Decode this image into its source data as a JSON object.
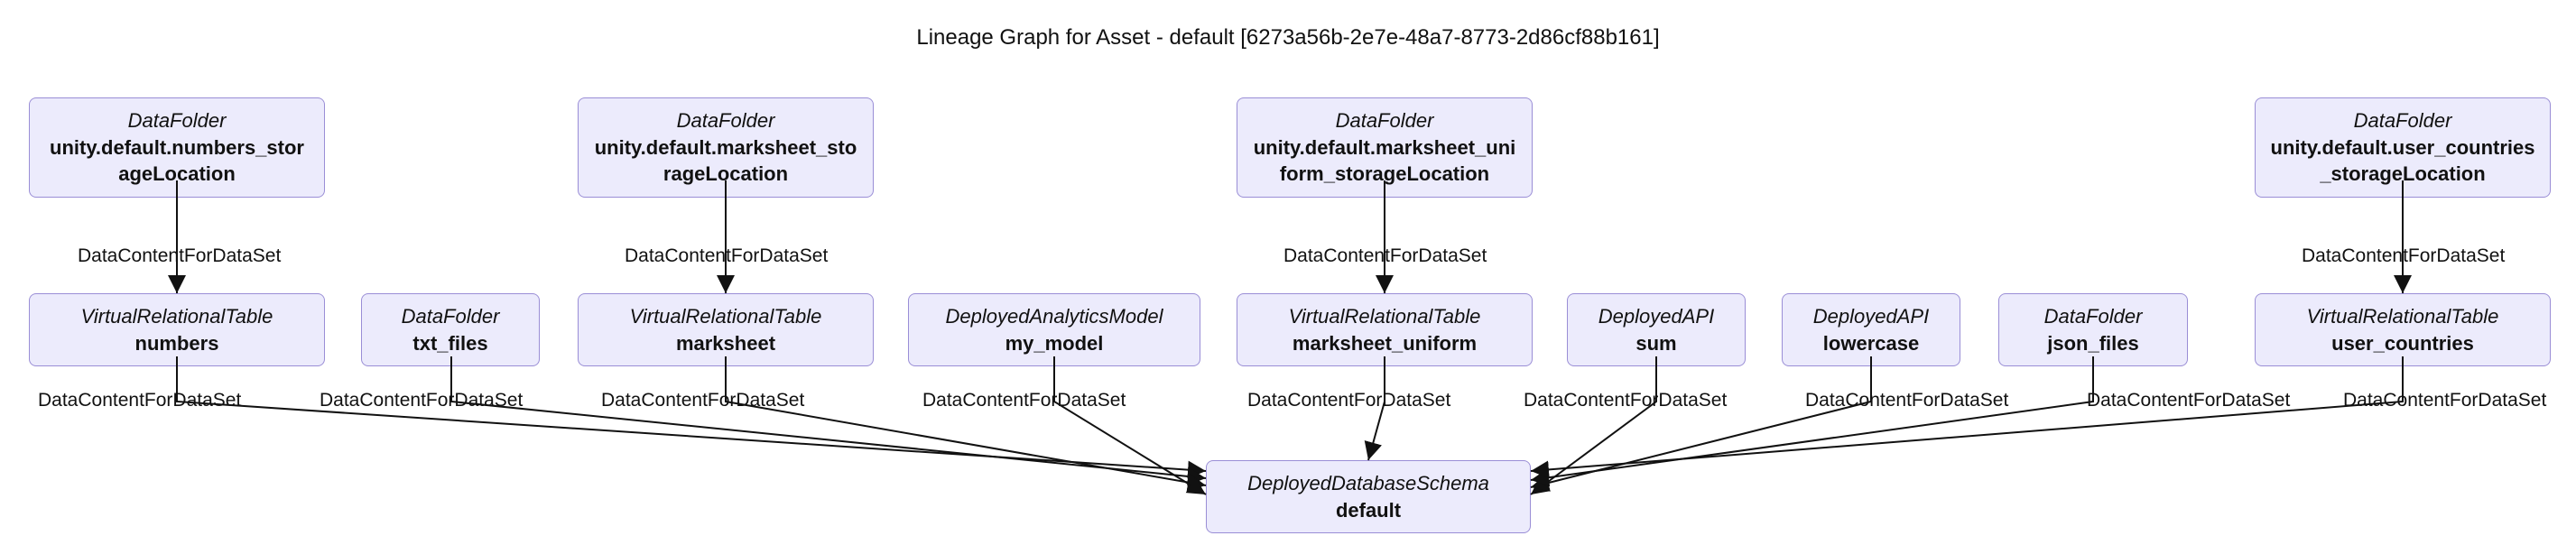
{
  "title": "Lineage Graph for Asset - default [6273a56b-2e7e-48a7-8773-2d86cf88b161]",
  "edge_label": "DataContentForDataSet",
  "nodes": {
    "folder_numbers": {
      "type": "DataFolder",
      "name": "unity.default.numbers_storageLocation"
    },
    "folder_marksheet": {
      "type": "DataFolder",
      "name": "unity.default.marksheet_storageLocation"
    },
    "folder_marksheet_u": {
      "type": "DataFolder",
      "name": "unity.default.marksheet_uniform_storageLocation"
    },
    "folder_user_countries": {
      "type": "DataFolder",
      "name": "unity.default.user_countries_storageLocation"
    },
    "tbl_numbers": {
      "type": "VirtualRelationalTable",
      "name": "numbers"
    },
    "folder_txt": {
      "type": "DataFolder",
      "name": "txt_files"
    },
    "tbl_marksheet": {
      "type": "VirtualRelationalTable",
      "name": "marksheet"
    },
    "model_my": {
      "type": "DeployedAnalyticsModel",
      "name": "my_model"
    },
    "tbl_marksheet_u": {
      "type": "VirtualRelationalTable",
      "name": "marksheet_uniform"
    },
    "api_sum": {
      "type": "DeployedAPI",
      "name": "sum"
    },
    "api_lowercase": {
      "type": "DeployedAPI",
      "name": "lowercase"
    },
    "folder_json": {
      "type": "DataFolder",
      "name": "json_files"
    },
    "tbl_user_countries": {
      "type": "VirtualRelationalTable",
      "name": "user_countries"
    },
    "schema_default": {
      "type": "DeployedDatabaseSchema",
      "name": "default"
    }
  }
}
